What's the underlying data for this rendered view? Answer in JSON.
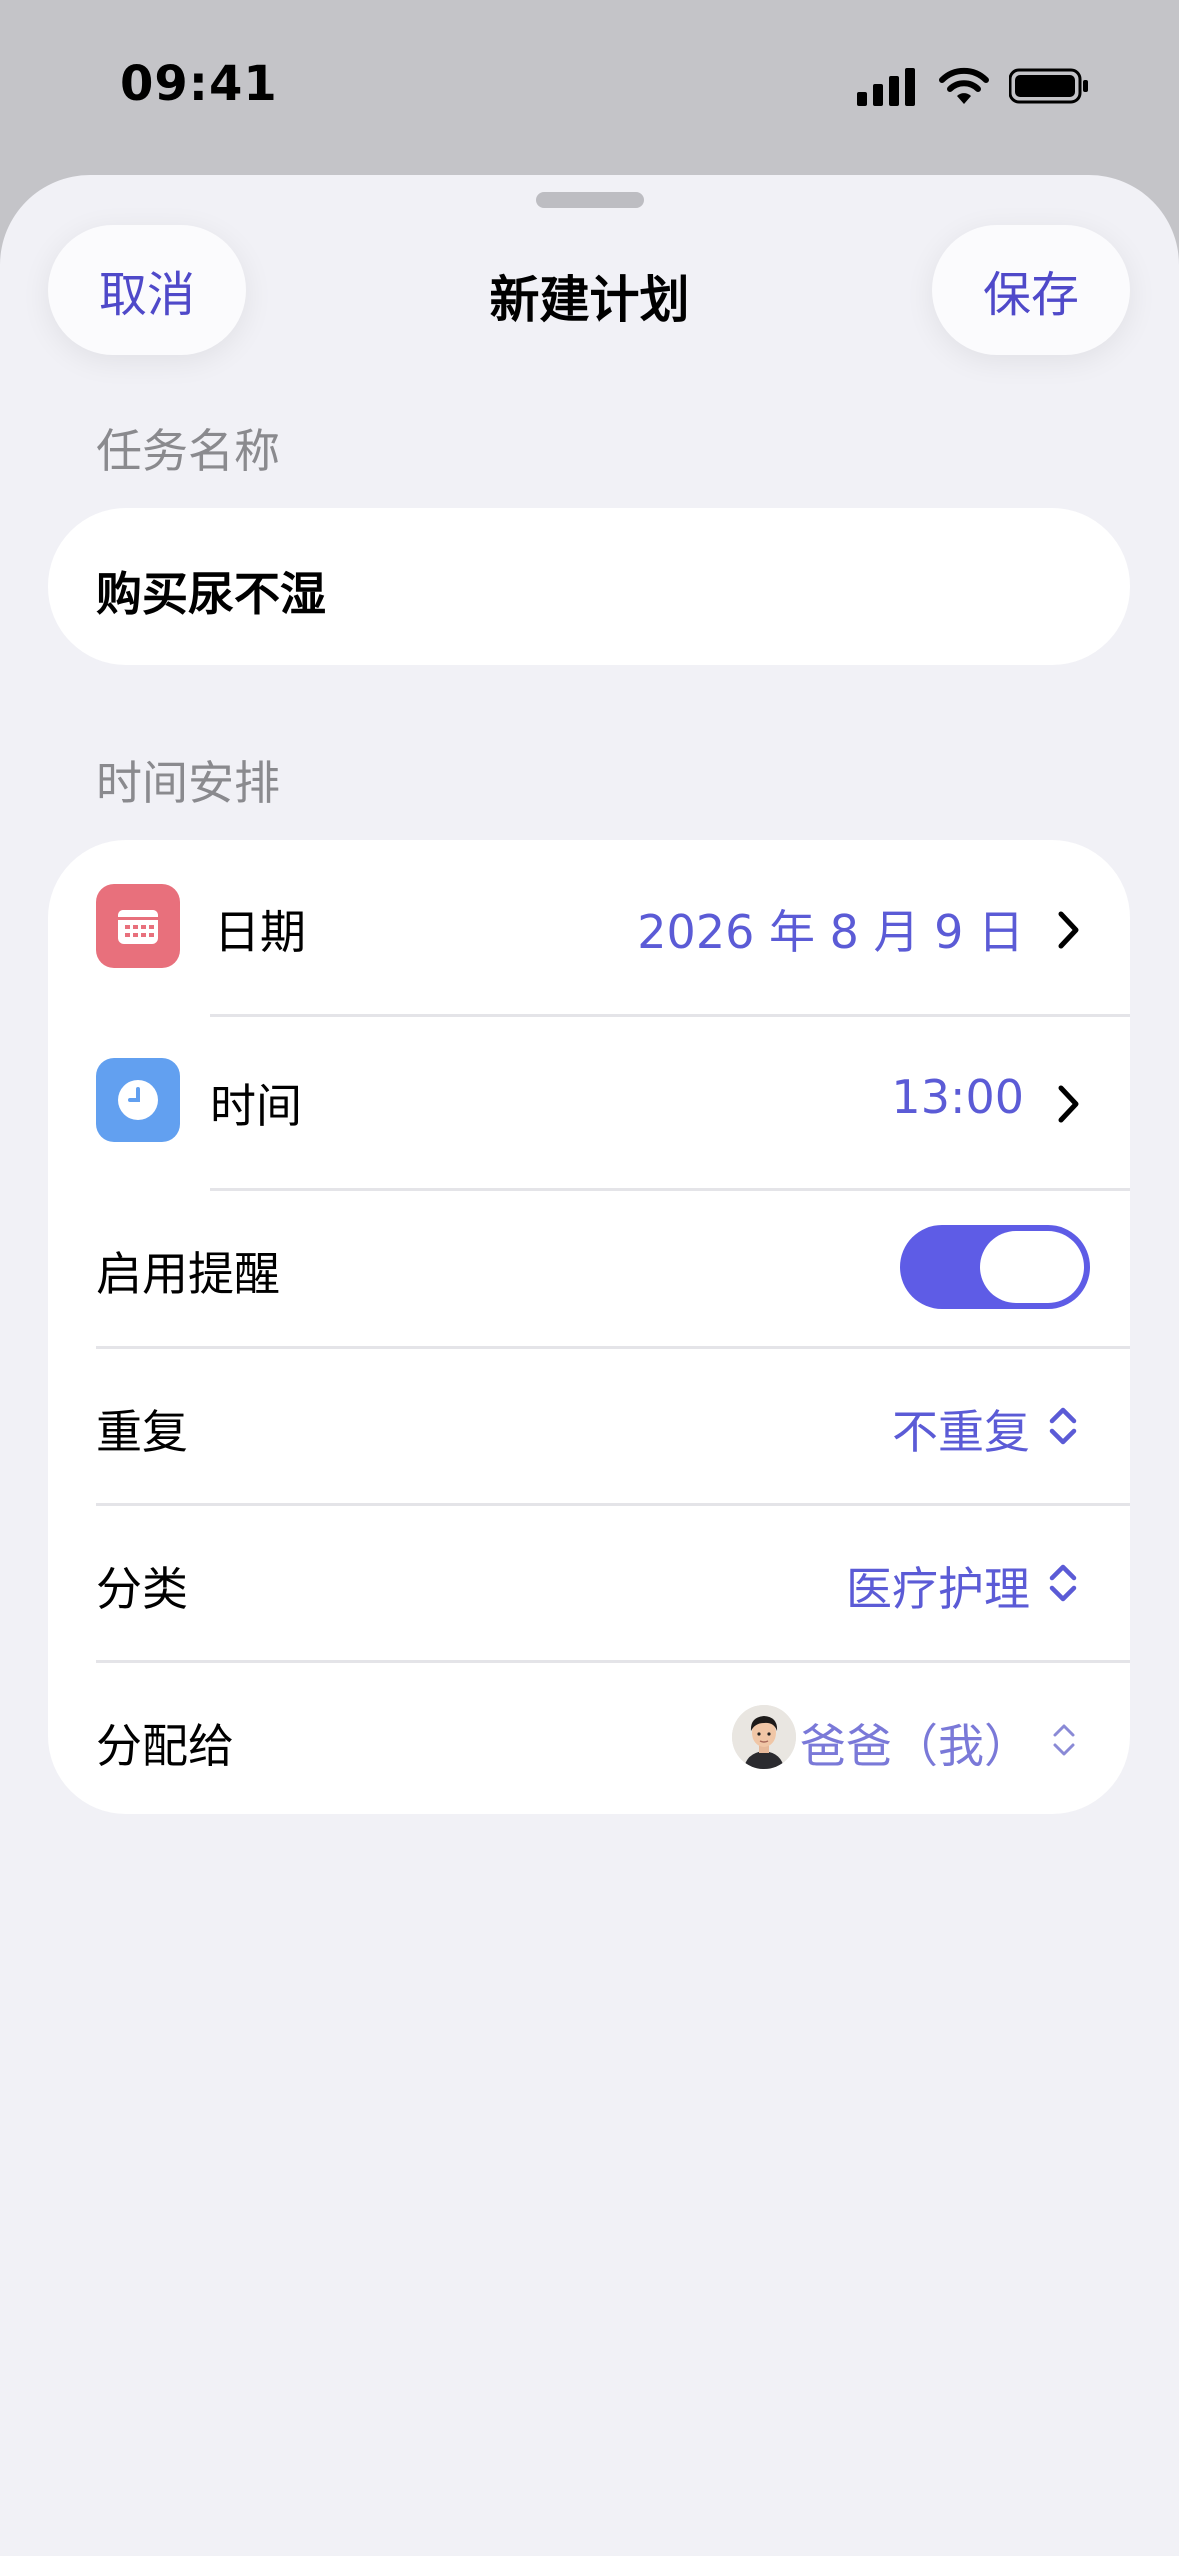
{
  "status_bar": {
    "time": "09:41"
  },
  "nav": {
    "cancel_label": "取消",
    "title": "新建计划",
    "save_label": "保存"
  },
  "task_name": {
    "section_label": "任务名称",
    "value": "购买尿不湿"
  },
  "schedule": {
    "section_label": "时间安排",
    "date": {
      "label": "日期",
      "value": "2026 年 8 月 9 日",
      "icon": "calendar-icon",
      "icon_color": "#e8707c"
    },
    "time": {
      "label": "时间",
      "value": "13:00",
      "icon": "clock-icon",
      "icon_color": "#62a0f0"
    },
    "reminder": {
      "label": "启用提醒",
      "enabled": true
    },
    "repeat": {
      "label": "重复",
      "value": "不重复"
    },
    "category": {
      "label": "分类",
      "value": "医疗护理"
    },
    "assignee": {
      "label": "分配给",
      "value": "爸爸（我）"
    }
  },
  "colors": {
    "accent": "#5b5bd6",
    "toggle_on": "#5e5ce6",
    "background": "#f1f1f6"
  }
}
